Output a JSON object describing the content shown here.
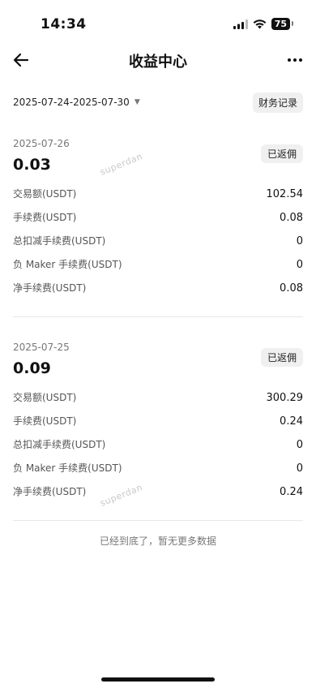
{
  "status_bar": {
    "time": "14:34",
    "battery": "75"
  },
  "nav": {
    "title": "收益中心"
  },
  "filter": {
    "date_range": "2025-07-24-2025-07-30",
    "records_button": "财务记录"
  },
  "watermark": "superdan",
  "records": [
    {
      "date": "2025-07-26",
      "amount": "0.03",
      "status": "已返佣",
      "rows": [
        {
          "label": "交易额(USDT)",
          "value": "102.54"
        },
        {
          "label": "手续费(USDT)",
          "value": "0.08"
        },
        {
          "label": "总扣减手续费(USDT)",
          "value": "0"
        },
        {
          "label": "负 Maker 手续费(USDT)",
          "value": "0"
        },
        {
          "label": "净手续费(USDT)",
          "value": "0.08"
        }
      ]
    },
    {
      "date": "2025-07-25",
      "amount": "0.09",
      "status": "已返佣",
      "rows": [
        {
          "label": "交易额(USDT)",
          "value": "300.29"
        },
        {
          "label": "手续费(USDT)",
          "value": "0.24"
        },
        {
          "label": "总扣减手续费(USDT)",
          "value": "0"
        },
        {
          "label": "负 Maker 手续费(USDT)",
          "value": "0"
        },
        {
          "label": "净手续费(USDT)",
          "value": "0.24"
        }
      ]
    }
  ],
  "footer": {
    "end_text": "已经到底了，暂无更多数据"
  }
}
